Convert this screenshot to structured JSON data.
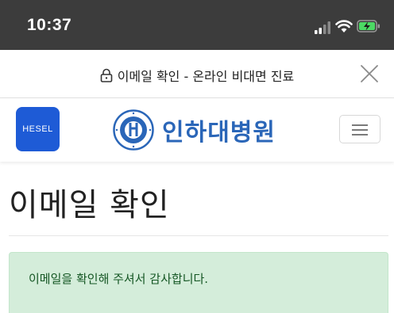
{
  "status_bar": {
    "time": "10:37",
    "icons": [
      "signal-icon",
      "wifi-icon",
      "battery-charging-icon"
    ]
  },
  "modal": {
    "title": "이메일 확인 - 온라인 비대면 진료",
    "lock_icon": "lock-icon",
    "close_icon": "close-icon"
  },
  "nav": {
    "hesel_label": "HESEL",
    "brand_name": "인하대병원",
    "emblem": "hospital-emblem-icon",
    "menu_icon": "hamburger-menu-icon"
  },
  "main": {
    "page_title": "이메일 확인",
    "alert_message": "이메일을 확인해 주셔서 감사합니다."
  },
  "colors": {
    "status_bar_bg": "#3c3c3c",
    "hesel_blue": "#1e5bd6",
    "brand_blue": "#2a66b8",
    "alert_bg": "#d4edda",
    "alert_text": "#155724",
    "battery_green": "#4cd964"
  }
}
